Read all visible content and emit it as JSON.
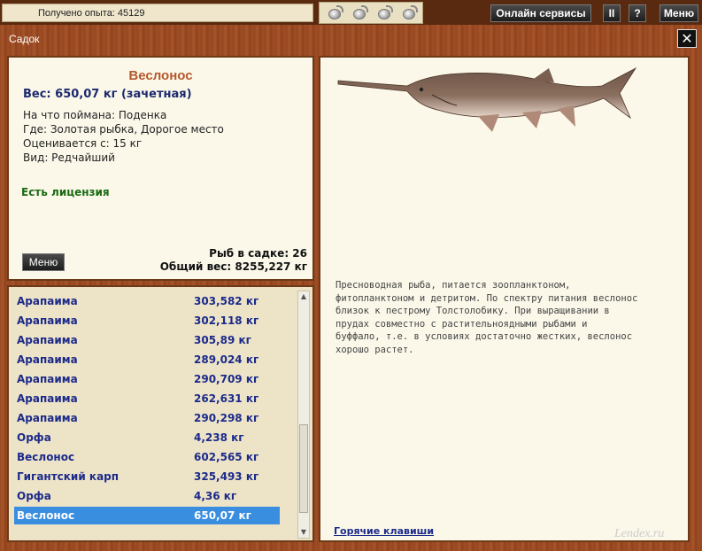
{
  "topbar": {
    "xp_text": "Получено опыта: 45129",
    "online_label": "Онлайн сервисы",
    "pause_label": "II",
    "help_label": "?",
    "menu_label": "Меню"
  },
  "window": {
    "title": "Садок",
    "close_label": "✕"
  },
  "fish_info": {
    "name": "Веслонос",
    "weight_line": "Вес: 650,07 кг (зачетная)",
    "caught_on": "На что поймана: Поденка",
    "location": "Где: Золотая рыбка, Дорогое место",
    "rated_from": "Оценивается с: 15 кг",
    "kind": "Вид: Редчайший",
    "license": "Есть лицензия",
    "menu_button": "Меню",
    "count_line": "Рыб в садке: 26",
    "total_line": "Общий вес: 8255,227 кг"
  },
  "fish_list": [
    {
      "name": "Арапаима",
      "weight": "303,582 кг"
    },
    {
      "name": "Арапаима",
      "weight": "302,118 кг"
    },
    {
      "name": "Арапаима",
      "weight": "305,89 кг"
    },
    {
      "name": "Арапаима",
      "weight": "289,024 кг"
    },
    {
      "name": "Арапаима",
      "weight": "290,709 кг"
    },
    {
      "name": "Арапаима",
      "weight": "262,631 кг"
    },
    {
      "name": "Арапаима",
      "weight": "290,298 кг"
    },
    {
      "name": "Орфа",
      "weight": "4,238 кг"
    },
    {
      "name": "Веслонос",
      "weight": "602,565 кг"
    },
    {
      "name": "Гигантский карп",
      "weight": "325,493 кг"
    },
    {
      "name": "Орфа",
      "weight": "4,36 кг"
    },
    {
      "name": "Веслонос",
      "weight": "650,07 кг"
    }
  ],
  "selected_index": 11,
  "description": {
    "lines": [
      "Пресноводная рыба, питается зоопланктоном,",
      "фитопланктоном и детритом. По спектру питания веслонос",
      "близок к пестрому Толстолобику. При выращивании в",
      "прудах совместно с растительноядными рыбами и",
      "буффало, т.е. в условиях достаточно жестких, веслонос",
      "хорошо растет."
    ],
    "hotkeys": "Горячие клавиши"
  },
  "watermark": "Lendex.ru",
  "colors": {
    "wood": "#9a4a22",
    "panel": "#fbf8ea",
    "list_bg": "#ede4c8",
    "fish_name": "#b5582a",
    "list_text": "#1c2a8a",
    "selected_row": "#3a8ee0",
    "license": "#1a6a12"
  }
}
